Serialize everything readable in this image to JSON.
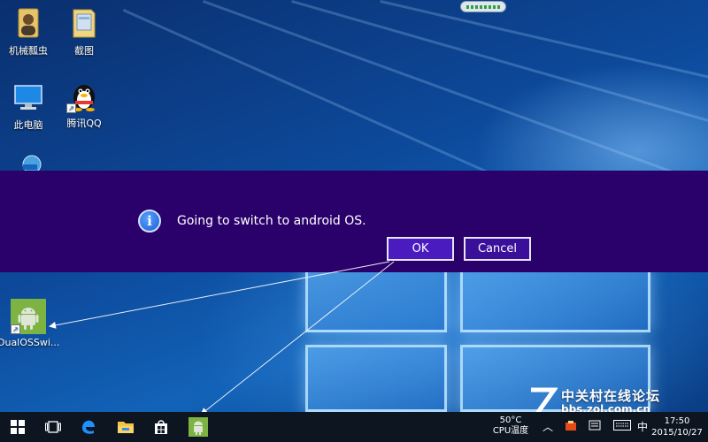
{
  "desktop": {
    "icons": [
      {
        "label": "机械瓢虫",
        "icon": "folder-user-icon"
      },
      {
        "label": "截图",
        "icon": "folder-icon"
      },
      {
        "label": "此电脑",
        "icon": "computer-icon"
      },
      {
        "label": "腾讯QQ",
        "icon": "qq-penguin-icon"
      },
      {
        "label": "DualOSSwi...",
        "icon": "android-icon"
      }
    ]
  },
  "dialog": {
    "message": "Going to switch to android OS.",
    "ok_label": "OK",
    "cancel_label": "Cancel",
    "background": "#2a006b",
    "button_background": "#3a0f9a"
  },
  "watermark": {
    "title": "中关村在线论坛",
    "url": "bbs.zol.com.cn"
  },
  "taskbar": {
    "temperature": "50°C",
    "temperature_label": "CPU温度",
    "ime": "中",
    "time": "17:50",
    "date": "2015/10/27",
    "background": "#0d1521"
  }
}
